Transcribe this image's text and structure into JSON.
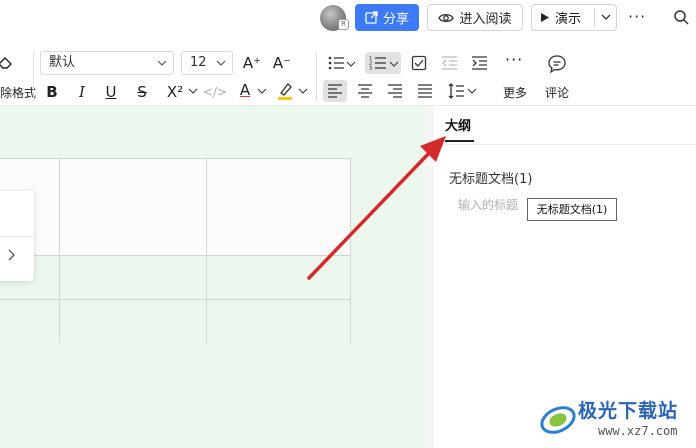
{
  "header": {
    "share_label": "分享",
    "read_label": "进入阅读",
    "present_label": "演示",
    "more_glyph": "···"
  },
  "toolbar": {
    "clear_format_label": "除格式",
    "font_family": "默认",
    "font_size": "12",
    "increase_font_label": "A⁺",
    "decrease_font_label": "A⁻",
    "bold_label": "B",
    "italic_label": "I",
    "underline_label": "U",
    "strikethrough_label": "S",
    "superscript_label": "X²",
    "code_label": "</>",
    "font_color_label": "A",
    "more_label": "更多",
    "comment_label": "评论",
    "colors": {
      "font_color": "#d9362f",
      "highlight_color": "#f5c518"
    }
  },
  "outline": {
    "tab_label": "大纲",
    "doc_title": "无标题文档(1)",
    "placeholder_hint": "输入的标题",
    "tooltip_text": "无标题文档(1)"
  },
  "watermark": {
    "site_name": "极光下载站",
    "url": "www.xz7.com"
  },
  "colors": {
    "accent": "#3c7af6",
    "editor_background": "#ecf7ee",
    "annotation_arrow": "#d42a2a"
  }
}
